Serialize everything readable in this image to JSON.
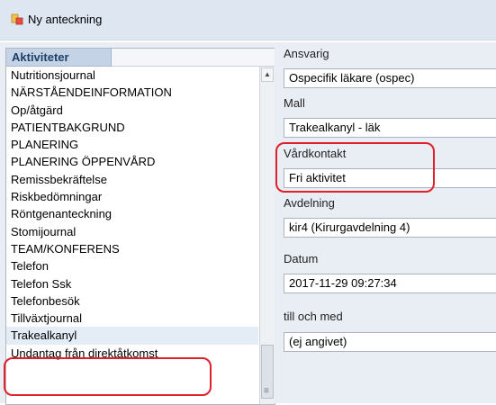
{
  "window": {
    "title": "Ny anteckning",
    "icon": "note-app-icon"
  },
  "activities": {
    "header": "Aktiviteter",
    "items": [
      "Nutritionsjournal",
      "NÄRSTÅENDEINFORMATION",
      "Op/åtgärd",
      "PATIENTBAKGRUND",
      "PLANERING",
      "PLANERING ÖPPENVÅRD",
      "Remissbekräftelse",
      "Riskbedömningar",
      "Röntgenanteckning",
      "Stomijournal",
      "TEAM/KONFERENS",
      "Telefon",
      "Telefon Ssk",
      "Telefonbesök",
      "Tillväxtjournal",
      "Trakealkanyl",
      "Undantag från direktåtkomst"
    ],
    "selected": "Trakealkanyl",
    "scroll_up_icon": "▲",
    "scroll_grip_icon": "≡"
  },
  "form": {
    "ansvarig": {
      "label": "Ansvarig",
      "value": "Ospecifik läkare (ospec)"
    },
    "mall": {
      "label": "Mall",
      "value": "Trakealkanyl - läk"
    },
    "vardkontakt": {
      "label": "Vårdkontakt",
      "value": "Fri aktivitet"
    },
    "avdelning": {
      "label": "Avdelning",
      "value": "kir4 (Kirurgavdelning 4)"
    },
    "datum": {
      "label": "Datum",
      "value": "2017-11-29 09:27:34"
    },
    "till_och_med": {
      "label": "till och med",
      "value": "(ej angivet)"
    }
  },
  "colors": {
    "annotation": "#e0202a",
    "header_text": "#1e3f66"
  }
}
